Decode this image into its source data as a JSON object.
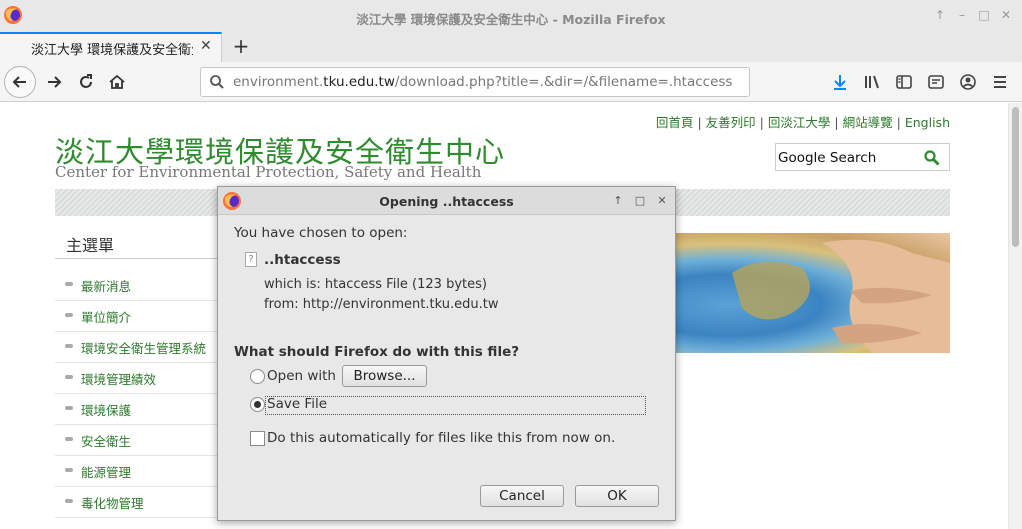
{
  "window": {
    "title": "淡江大學 環境保護及安全衛生中心 - Mozilla Firefox",
    "controls": [
      "↑",
      "–",
      "□",
      "✕"
    ]
  },
  "tabs": [
    {
      "label": "淡江大學 環境保護及安全衛生中",
      "close": "✕"
    }
  ],
  "new_tab": "+",
  "urlbar": {
    "prefix": "environment.",
    "domain": "tku.edu.tw",
    "suffix": "/download.php?title=.&dir=/&filename=.htaccess"
  },
  "page": {
    "top_links": [
      "回首頁",
      "友善列印",
      "回淡江大學",
      "網站導覽",
      "English"
    ],
    "top_links_sep": "|",
    "logo_cn": "淡江大學環境保護及安全衛生中心",
    "logo_en": "Center for Environmental Protection, Safety and Health",
    "search_label": "Google Search",
    "menu_title": "主選單",
    "menu_items": [
      "最新消息",
      "單位簡介",
      "環境安全衛生管理系統",
      "環境管理績效",
      "環境保護",
      "安全衛生",
      "能源管理",
      "毒化物管理"
    ]
  },
  "dialog": {
    "title": "Opening ..htaccess",
    "chosen_text": "You have chosen to open:",
    "filename": "..htaccess",
    "which_is": "which is: htaccess File (123 bytes)",
    "from": "from: http://environment.tku.edu.tw",
    "question": "What should Firefox do with this file?",
    "open_with_label": "Open with",
    "browse_label": "Browse...",
    "save_file_label": "Save File",
    "auto_label": "Do this automatically for files like this from now on.",
    "cancel_label": "Cancel",
    "ok_label": "OK",
    "selected_option": "save-file",
    "auto_checked": false,
    "title_buttons": [
      "↑",
      "□",
      "✕"
    ]
  },
  "colors": {
    "accent": "#0a84ff",
    "site_green": "#2e8b2e",
    "download_blue": "#0a84ff"
  }
}
